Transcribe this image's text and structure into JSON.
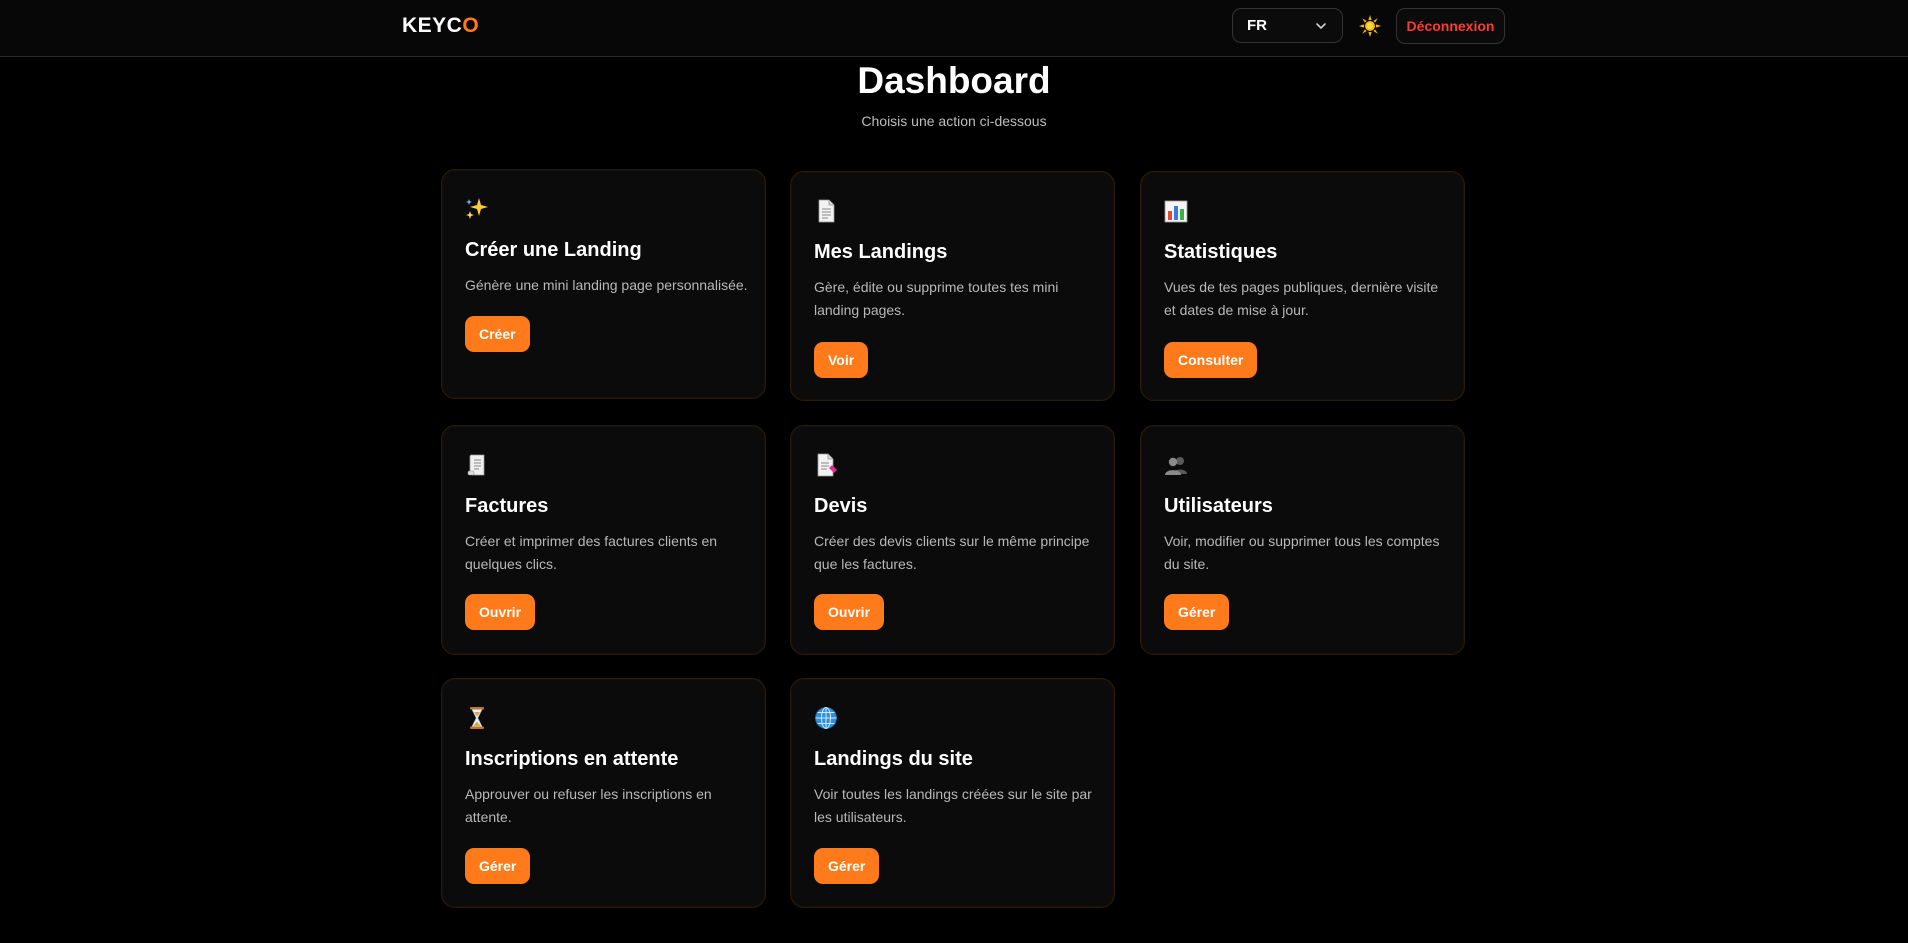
{
  "header": {
    "logo_main": "KEYC",
    "logo_accent": "O",
    "language": "FR",
    "theme_icon": "sun-icon",
    "logout_label": "Déconnexion"
  },
  "page": {
    "title": "Dashboard",
    "subtitle": "Choisis une action ci-dessous"
  },
  "colors": {
    "accent": "#ff7a1a",
    "danger": "#ff3b30",
    "background": "#000000",
    "card_background": "#0b0b0b"
  },
  "cards": [
    {
      "icon": "sparkles-icon",
      "title": "Créer une Landing",
      "description": "Génère une mini landing page personnalisée.",
      "button": "Créer"
    },
    {
      "icon": "document-icon",
      "title": "Mes Landings",
      "description": "Gère, édite ou supprime toutes tes mini landing pages.",
      "button": "Voir"
    },
    {
      "icon": "bar-chart-icon",
      "title": "Statistiques",
      "description": "Vues de tes pages publiques, dernière visite et dates de mise à jour.",
      "button": "Consulter"
    },
    {
      "icon": "receipt-icon",
      "title": "Factures",
      "description": "Créer et imprimer des factures clients en quelques clics.",
      "button": "Ouvrir"
    },
    {
      "icon": "quote-document-icon",
      "title": "Devis",
      "description": "Créer des devis clients sur le même principe que les factures.",
      "button": "Ouvrir"
    },
    {
      "icon": "users-icon",
      "title": "Utilisateurs",
      "description": "Voir, modifier ou supprimer tous les comptes du site.",
      "button": "Gérer"
    },
    {
      "icon": "hourglass-icon",
      "title": "Inscriptions en attente",
      "description": "Approuver ou refuser les inscriptions en attente.",
      "button": "Gérer"
    },
    {
      "icon": "globe-icon",
      "title": "Landings du site",
      "description": "Voir toutes les landings créées sur le site par les utilisateurs.",
      "button": "Gérer"
    }
  ]
}
